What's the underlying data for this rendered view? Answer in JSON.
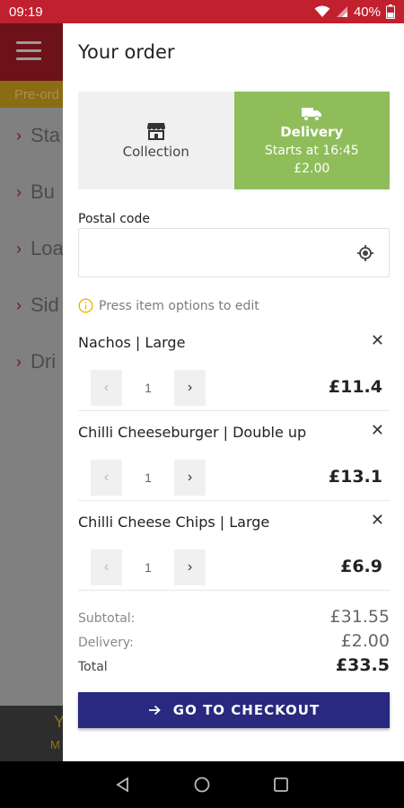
{
  "status_bar": {
    "time": "09:19",
    "battery": "40%"
  },
  "background": {
    "preorder_label": "Pre-ord",
    "categories": [
      "Sta",
      "Bu",
      "Loa",
      "Sid",
      "Dri"
    ],
    "bottom_label": "M"
  },
  "drawer": {
    "title": "Your order",
    "collection": {
      "label": "Collection",
      "icon": "store-icon"
    },
    "delivery": {
      "label": "Delivery",
      "starts": "Starts at 16:45",
      "fee": "£2.00",
      "icon": "truck-icon"
    },
    "postal": {
      "label": "Postal code",
      "value": "",
      "placeholder": ""
    },
    "hint": "Press item options to edit",
    "items": [
      {
        "name": "Nachos | Large",
        "qty": "1",
        "price": "£11.4"
      },
      {
        "name": "Chilli Cheeseburger | Double up",
        "qty": "1",
        "price": "£13.1"
      },
      {
        "name": "Chilli Cheese Chips | Large",
        "qty": "1",
        "price": "£6.9"
      }
    ],
    "totals": {
      "subtotal_label": "Subtotal:",
      "subtotal": "£31.55",
      "delivery_label": "Delivery:",
      "delivery": "£2.00",
      "total_label": "Total",
      "total": "£33.5"
    },
    "checkout_label": "GO TO CHECKOUT"
  },
  "colors": {
    "status_bar": "#c1202e",
    "delivery_active": "#8fbd5a",
    "checkout": "#28297f",
    "hint_icon": "#f0b400"
  }
}
